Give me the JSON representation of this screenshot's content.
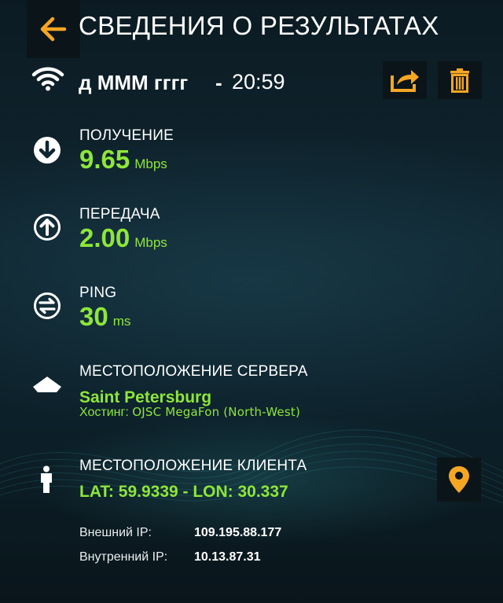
{
  "header": {
    "title": "СВЕДЕНИЯ О РЕЗУЛЬТАТАХ"
  },
  "test": {
    "name": "д МММ гггг",
    "separator": "-",
    "time": "20:59"
  },
  "metrics": {
    "download": {
      "label": "ПОЛУЧЕНИЕ",
      "value": "9.65",
      "unit": "Mbps"
    },
    "upload": {
      "label": "ПЕРЕДАЧА",
      "value": "2.00",
      "unit": "Mbps"
    },
    "ping": {
      "label": "PING",
      "value": "30",
      "unit": "ms"
    }
  },
  "server": {
    "label": "МЕСТОПОЛОЖЕНИЕ СЕРВЕРА",
    "city": "Saint Petersburg",
    "hosting_label": "Хостинг:",
    "hosting_value": "OJSC MegaFon (North-West)"
  },
  "client": {
    "label": "МЕСТОПОЛОЖЕНИЕ КЛИЕНТА",
    "coords": "LAT: 59.9339 - LON: 30.337",
    "external_ip_label": "Внешний IP:",
    "external_ip": "109.195.88.177",
    "internal_ip_label": "Внутренний IP:",
    "internal_ip": "10.13.87.31"
  },
  "colors": {
    "accent": "#f5a623",
    "value_green": "#8ee63a",
    "button_bg": "#0b1519"
  },
  "icons": {
    "back": "arrow-left-icon",
    "wifi": "wifi-icon",
    "share": "share-icon",
    "delete": "trash-icon",
    "download": "download-arrow-icon",
    "upload": "upload-arrow-icon",
    "ping": "ping-icon",
    "server": "server-location-icon",
    "client": "person-icon",
    "map": "map-pin-icon"
  }
}
